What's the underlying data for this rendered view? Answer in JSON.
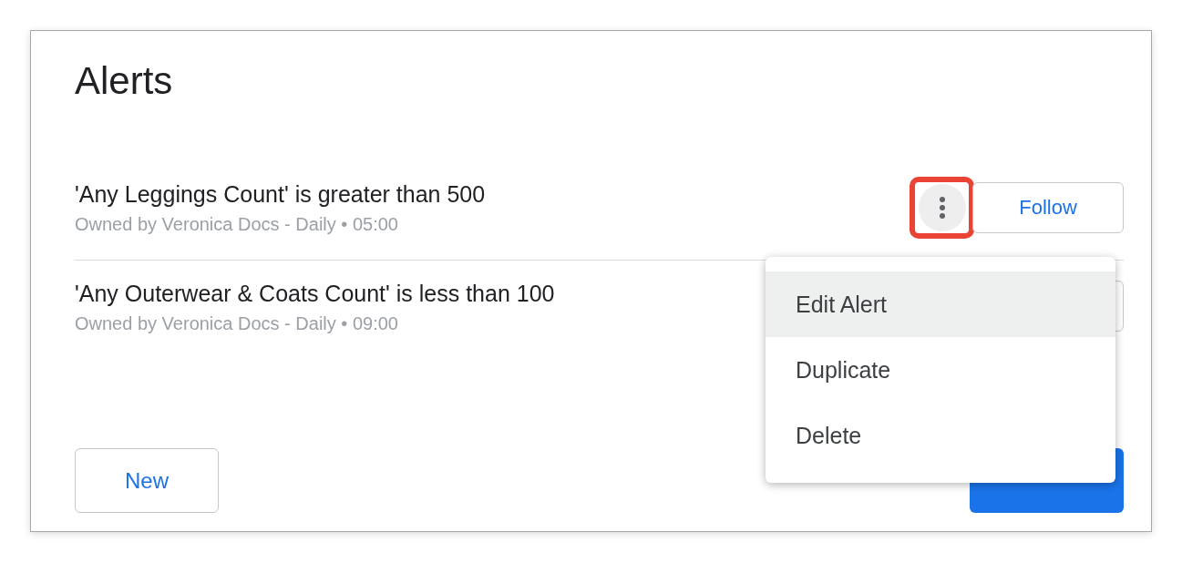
{
  "dialog": {
    "title": "Alerts"
  },
  "alerts": [
    {
      "title": "'Any Leggings Count' is greater than 500",
      "owner": "Owned by Veronica Docs - Daily • 05:00",
      "button": "Follow",
      "menu_open": true
    },
    {
      "title": "'Any Outerwear & Coats Count' is less than 100",
      "owner": "Owned by Veronica Docs - Daily • 09:00",
      "menu_open": false
    }
  ],
  "menu": {
    "items": [
      {
        "label": "Edit Alert",
        "selected": true
      },
      {
        "label": "Duplicate",
        "selected": false
      },
      {
        "label": "Delete",
        "selected": false
      }
    ]
  },
  "footer": {
    "new_button": "New"
  }
}
